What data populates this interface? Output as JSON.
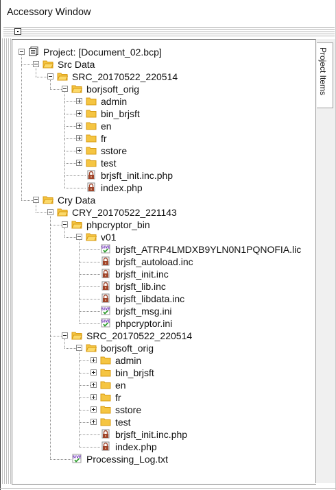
{
  "window": {
    "title": "Accessory Window"
  },
  "side_tab": {
    "label": "Project Items"
  },
  "tree": [
    {
      "label": "Project: [Document_02.bcp]",
      "icon": "document-icon",
      "depth": 0,
      "toggle": "minus"
    },
    {
      "label": "Src Data",
      "icon": "folder-open-icon",
      "depth": 1,
      "toggle": "minus"
    },
    {
      "label": "SRC_20170522_220514",
      "icon": "folder-open-icon",
      "depth": 2,
      "toggle": "minus"
    },
    {
      "label": "borjsoft_orig",
      "icon": "folder-open-icon",
      "depth": 3,
      "toggle": "minus"
    },
    {
      "label": "admin",
      "icon": "folder-icon",
      "depth": 4,
      "toggle": "plus"
    },
    {
      "label": "bin_brjsft",
      "icon": "folder-icon",
      "depth": 4,
      "toggle": "plus"
    },
    {
      "label": "en",
      "icon": "folder-icon",
      "depth": 4,
      "toggle": "plus"
    },
    {
      "label": "fr",
      "icon": "folder-icon",
      "depth": 4,
      "toggle": "plus"
    },
    {
      "label": "sstore",
      "icon": "folder-icon",
      "depth": 4,
      "toggle": "plus"
    },
    {
      "label": "test",
      "icon": "folder-icon",
      "depth": 4,
      "toggle": "plus"
    },
    {
      "label": "brjsft_init.inc.php",
      "icon": "locked-file-icon",
      "depth": 4,
      "toggle": ""
    },
    {
      "label": "index.php",
      "icon": "locked-file-icon",
      "depth": 4,
      "toggle": ""
    },
    {
      "label": "Cry Data",
      "icon": "folder-open-icon",
      "depth": 1,
      "toggle": "minus"
    },
    {
      "label": "CRY_20170522_221143",
      "icon": "folder-open-icon",
      "depth": 2,
      "toggle": "minus"
    },
    {
      "label": "phpcryptor_bin",
      "icon": "folder-open-icon",
      "depth": 3,
      "toggle": "minus"
    },
    {
      "label": "v01",
      "icon": "folder-open-icon",
      "depth": 4,
      "toggle": "minus"
    },
    {
      "label": "brjsft_ATRP4LMDXB9YLN0N1PQNOFIA.lic",
      "icon": "signed-file-icon",
      "depth": 5,
      "toggle": ""
    },
    {
      "label": "brjsft_autoload.inc",
      "icon": "locked-file-icon",
      "depth": 5,
      "toggle": ""
    },
    {
      "label": "brjsft_init.inc",
      "icon": "locked-file-icon",
      "depth": 5,
      "toggle": ""
    },
    {
      "label": "brjsft_lib.inc",
      "icon": "locked-file-icon",
      "depth": 5,
      "toggle": ""
    },
    {
      "label": "brjsft_libdata.inc",
      "icon": "locked-file-icon",
      "depth": 5,
      "toggle": ""
    },
    {
      "label": "brjsft_msg.ini",
      "icon": "signed-file-icon",
      "depth": 5,
      "toggle": ""
    },
    {
      "label": "phpcryptor.ini",
      "icon": "signed-file-icon",
      "depth": 5,
      "toggle": ""
    },
    {
      "label": "SRC_20170522_220514",
      "icon": "folder-open-icon",
      "depth": 3,
      "toggle": "minus"
    },
    {
      "label": "borjsoft_orig",
      "icon": "folder-open-icon",
      "depth": 4,
      "toggle": "minus"
    },
    {
      "label": "admin",
      "icon": "folder-icon",
      "depth": 5,
      "toggle": "plus"
    },
    {
      "label": "bin_brjsft",
      "icon": "folder-icon",
      "depth": 5,
      "toggle": "plus"
    },
    {
      "label": "en",
      "icon": "folder-icon",
      "depth": 5,
      "toggle": "plus"
    },
    {
      "label": "fr",
      "icon": "folder-icon",
      "depth": 5,
      "toggle": "plus"
    },
    {
      "label": "sstore",
      "icon": "folder-icon",
      "depth": 5,
      "toggle": "plus"
    },
    {
      "label": "test",
      "icon": "folder-icon",
      "depth": 5,
      "toggle": "plus"
    },
    {
      "label": "brjsft_init.inc.php",
      "icon": "locked-file-icon",
      "depth": 5,
      "toggle": ""
    },
    {
      "label": "index.php",
      "icon": "locked-file-icon",
      "depth": 5,
      "toggle": ""
    },
    {
      "label": "Processing_Log.txt",
      "icon": "signed-file-icon",
      "depth": 3,
      "toggle": ""
    }
  ],
  "colors": {
    "folder": "#f5c542",
    "folder_dark": "#d89b12",
    "lock": "#a0442a",
    "signed_text": "#6a2bb5",
    "check": "#2e9e2e"
  }
}
